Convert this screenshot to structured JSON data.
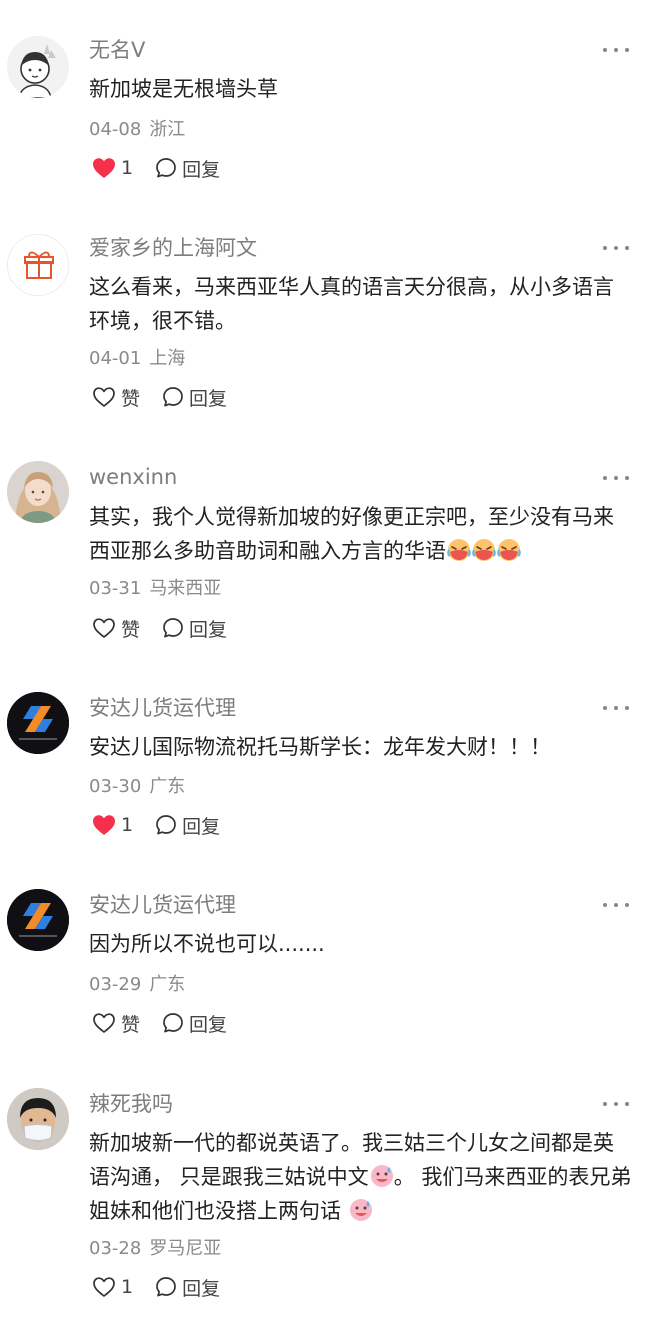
{
  "comments": [
    {
      "username": "无名V",
      "text": "新加坡是无根墙头草",
      "emojis": 0,
      "date": "04-08",
      "location": "浙江",
      "like_label": "1",
      "liked": true,
      "reply_label": "回复"
    },
    {
      "username": "爱家乡的上海阿文",
      "text": "这么看来，马来西亚华人真的语言天分很高，从小多语言环境，很不错。",
      "emojis": 0,
      "date": "04-01",
      "location": "上海",
      "like_label": "赞",
      "liked": false,
      "reply_label": "回复"
    },
    {
      "username": "wenxinn",
      "text": "其实，我个人觉得新加坡的好像更正宗吧，至少没有马来西亚那么多助音助词和融入方言的华语",
      "emojis": 3,
      "date": "03-31",
      "location": "马来西亚",
      "like_label": "赞",
      "liked": false,
      "reply_label": "回复"
    },
    {
      "username": "安达儿货运代理",
      "text": "安达儿国际物流祝托马斯学长：龙年发大财！！！",
      "emojis": 0,
      "date": "03-30",
      "location": "广东",
      "like_label": "1",
      "liked": true,
      "reply_label": "回复"
    },
    {
      "username": "安达儿货运代理",
      "text": "因为所以不说也可以.......",
      "emojis": 0,
      "date": "03-29",
      "location": "广东",
      "like_label": "赞",
      "liked": false,
      "reply_label": "回复"
    },
    {
      "username": "辣死我吗",
      "text_parts": [
        "新加坡新一代的都说英语了。我三姑三个儿女之间都是英语沟通， 只是跟我三姑说中文",
        "。 我们马来西亚的表兄弟姐妹和他们也没搭上两句话 "
      ],
      "date": "03-28",
      "location": "罗马尼亚",
      "like_label": "1",
      "liked": false,
      "reply_label": "回复"
    }
  ],
  "colors": {
    "like_red": "#f5304b",
    "meta_gray": "#8a8a8a",
    "name_gray": "#7d7d7d"
  }
}
